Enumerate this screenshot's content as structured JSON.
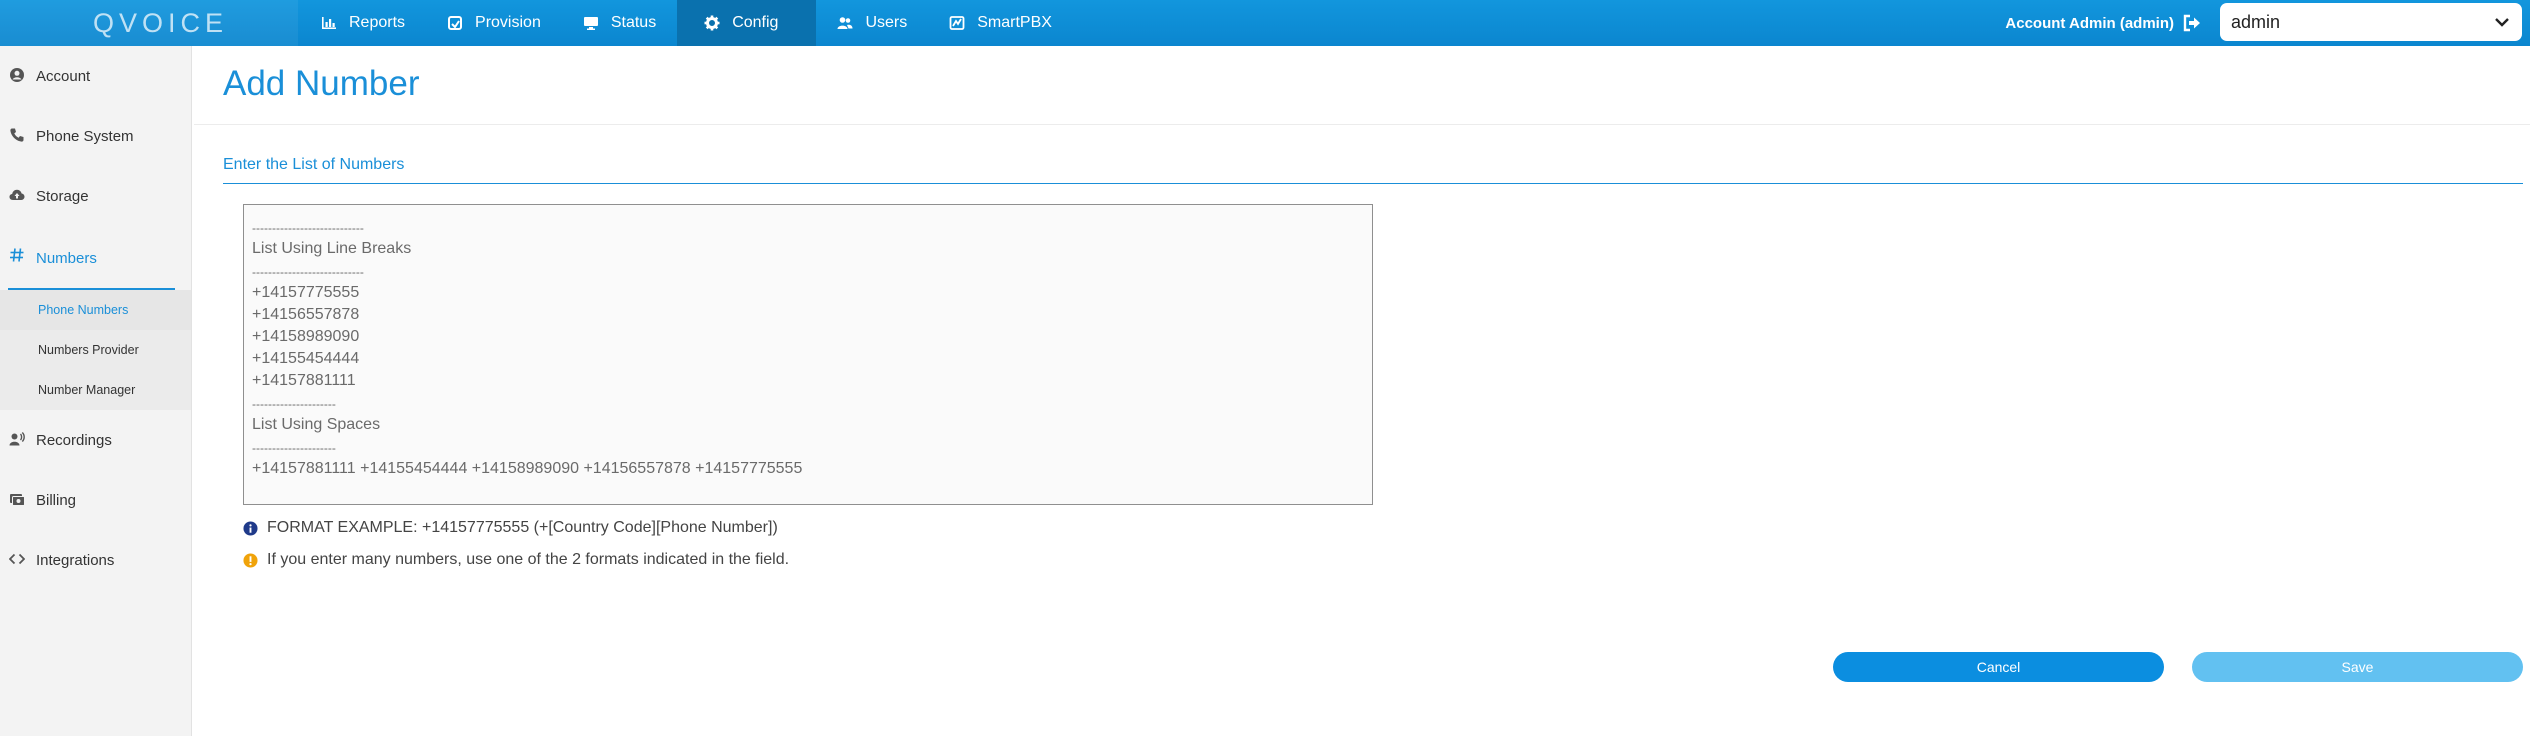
{
  "app": {
    "logo": "QVOICE"
  },
  "nav": {
    "items": [
      {
        "label": "Reports",
        "icon": "bar-chart-icon"
      },
      {
        "label": "Provision",
        "icon": "provision-icon"
      },
      {
        "label": "Status",
        "icon": "monitor-icon"
      },
      {
        "label": "Config",
        "icon": "gear-icon",
        "active": true
      },
      {
        "label": "Users",
        "icon": "users-icon"
      },
      {
        "label": "SmartPBX",
        "icon": "smartpbx-icon"
      }
    ],
    "account_label": "Account Admin (admin)",
    "account_select": "admin"
  },
  "sidebar": {
    "items": [
      {
        "label": "Account",
        "icon": "user-circle-icon"
      },
      {
        "label": "Phone System",
        "icon": "phone-icon"
      },
      {
        "label": "Storage",
        "icon": "cloud-icon"
      },
      {
        "label": "Numbers",
        "icon": "hash-icon",
        "active": true
      },
      {
        "label": "Recordings",
        "icon": "recordings-icon"
      },
      {
        "label": "Billing",
        "icon": "billing-icon"
      },
      {
        "label": "Integrations",
        "icon": "code-icon"
      }
    ],
    "sub_items": [
      {
        "label": "Phone Numbers",
        "active": true
      },
      {
        "label": "Numbers Provider"
      },
      {
        "label": "Number Manager"
      }
    ]
  },
  "main": {
    "title": "Add Number",
    "section_title": "Enter the List of Numbers",
    "textarea_lines": [
      {
        "text": "----------------------------",
        "dash": true
      },
      {
        "text": "List Using Line Breaks"
      },
      {
        "text": "----------------------------",
        "dash": true
      },
      {
        "text": "+14157775555"
      },
      {
        "text": "+14156557878"
      },
      {
        "text": "+14158989090"
      },
      {
        "text": "+14155454444"
      },
      {
        "text": "+14157881111"
      },
      {
        "text": "---------------------",
        "dash": true
      },
      {
        "text": "List Using Spaces"
      },
      {
        "text": "---------------------",
        "dash": true
      },
      {
        "text": "+14157881111 +14155454444 +14158989090 +14156557878 +14157775555"
      }
    ],
    "hint_format": "FORMAT EXAMPLE: +14157775555 (+[Country Code][Phone Number])",
    "hint_many": "If you enter many numbers, use one of the 2 formats indicated in the field.",
    "cancel_label": "Cancel",
    "save_label": "Save"
  },
  "colors": {
    "topbar": "#0b86cf",
    "accent": "#1a8fd8",
    "info_icon": "#1f3a8a",
    "warning_icon": "#f0a30a",
    "cancel_button": "#0b8ee0",
    "save_button": "#62c1f1"
  }
}
